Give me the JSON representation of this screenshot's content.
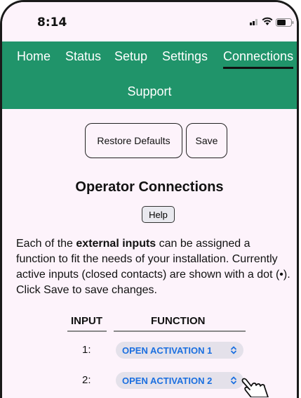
{
  "status_bar": {
    "time": "8:14",
    "icons": [
      "signal-icon",
      "wifi-icon",
      "battery-icon"
    ]
  },
  "nav": {
    "items": [
      {
        "label": "Home"
      },
      {
        "label": "Status"
      },
      {
        "label": "Setup"
      },
      {
        "label": "Settings"
      },
      {
        "label": "Connections",
        "active": true
      },
      {
        "label": "Support"
      }
    ]
  },
  "toolbar": {
    "restore_label": "Restore Defaults",
    "save_label": "Save"
  },
  "page": {
    "title": "Operator Connections",
    "help_label": "Help",
    "desc_pre": "Each of the ",
    "desc_bold": "external inputs",
    "desc_post": " can be assigned a function to fit the needs of your installation. Currently active inputs (closed contacts) are shown with a dot (•). Click Save to save changes."
  },
  "table": {
    "headers": {
      "input": "INPUT",
      "function": "FUNCTION"
    },
    "rows": [
      {
        "input": "1:",
        "function": "OPEN ACTIVATION 1"
      },
      {
        "input": "2:",
        "function": "OPEN ACTIVATION 2"
      }
    ]
  },
  "colors": {
    "nav_bg": "#20946a",
    "page_bg": "#fdf3fb",
    "select_text": "#1b6fe0"
  }
}
